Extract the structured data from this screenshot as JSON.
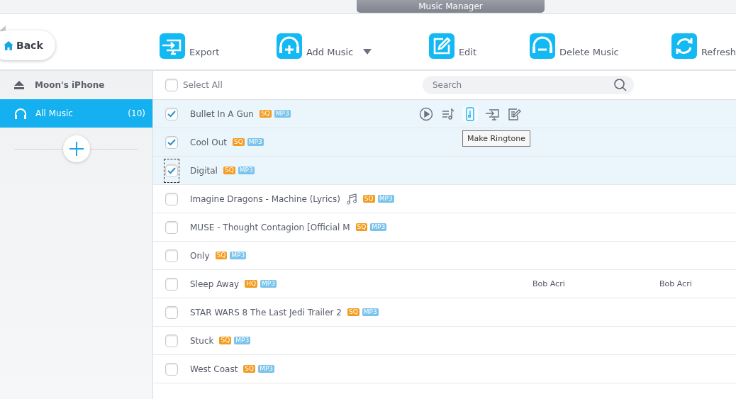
{
  "window": {
    "title": "Music Manager"
  },
  "back_button": {
    "label": "Back"
  },
  "toolbar": [
    {
      "kind": "export",
      "label": "Export",
      "dropdown": false
    },
    {
      "kind": "add",
      "label": "Add Music",
      "dropdown": true
    },
    {
      "kind": "edit",
      "label": "Edit",
      "dropdown": false
    },
    {
      "kind": "delete",
      "label": "Delete Music",
      "dropdown": false
    },
    {
      "kind": "refresh",
      "label": "Refresh",
      "dropdown": false
    }
  ],
  "sidebar": {
    "device": "Moon's iPhone",
    "items": [
      {
        "label": "All Music",
        "count": "(10)",
        "selected": true
      }
    ]
  },
  "list_header": {
    "select_all": {
      "label": "Select All",
      "checked": false
    },
    "search": {
      "placeholder": "Search"
    }
  },
  "rows": [
    {
      "title": "Bullet In A Gun",
      "quality": "SQ",
      "format": "MP3",
      "checked": true,
      "focused": false,
      "note_icon": false,
      "actions": [
        {
          "kind": "play",
          "highlighted": false
        },
        {
          "kind": "playlist",
          "highlighted": false
        },
        {
          "kind": "ringtone",
          "highlighted": true
        },
        {
          "kind": "export",
          "highlighted": false
        },
        {
          "kind": "edit",
          "highlighted": false
        }
      ]
    },
    {
      "title": "Cool Out",
      "quality": "SQ",
      "format": "MP3",
      "checked": true,
      "focused": false,
      "note_icon": false
    },
    {
      "title": "Digital",
      "quality": "SQ",
      "format": "MP3",
      "checked": true,
      "focused": true,
      "note_icon": false
    },
    {
      "title": "Imagine Dragons - Machine (Lyrics)",
      "quality": "SQ",
      "format": "MP3",
      "checked": false,
      "focused": false,
      "note_icon": true
    },
    {
      "title": "MUSE - Thought Contagion [Official M",
      "quality": "SQ",
      "format": "MP3",
      "checked": false,
      "focused": false,
      "note_icon": false
    },
    {
      "title": "Only",
      "quality": "SQ",
      "format": "MP3",
      "checked": false,
      "focused": false,
      "note_icon": false
    },
    {
      "title": "Sleep Away",
      "quality": "HQ",
      "format": "MP3",
      "checked": false,
      "focused": false,
      "note_icon": false,
      "column_3": "Bob Acri",
      "column_4": "Bob Acri"
    },
    {
      "title": "STAR WARS 8 The Last Jedi Trailer 2",
      "quality": "SQ",
      "format": "MP3",
      "checked": false,
      "focused": false,
      "note_icon": false
    },
    {
      "title": "Stuck",
      "quality": "SQ",
      "format": "MP3",
      "checked": false,
      "focused": false,
      "note_icon": false
    },
    {
      "title": "West Coast",
      "quality": "SQ",
      "format": "MP3",
      "checked": false,
      "focused": false,
      "note_icon": false
    }
  ],
  "tooltip": {
    "text": "Make Ringtone"
  }
}
